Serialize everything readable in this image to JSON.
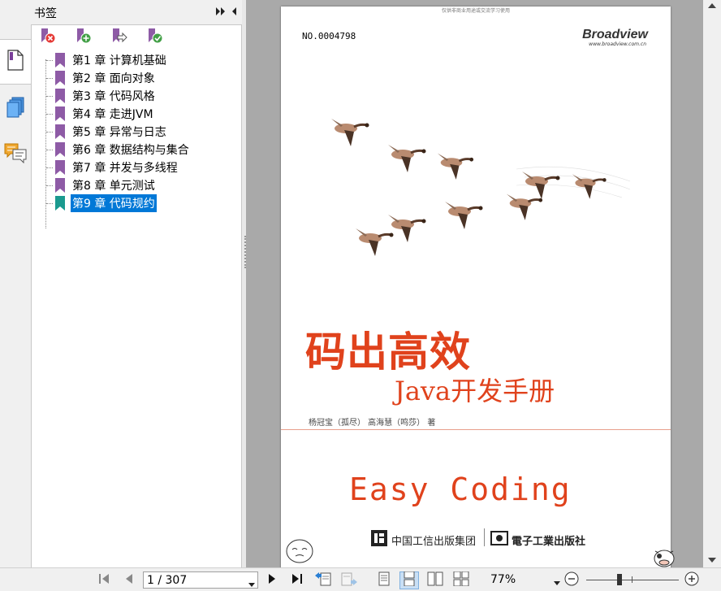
{
  "panel": {
    "title": "书签"
  },
  "bookmarks": [
    {
      "label": "第1 章 计算机基础",
      "selected": false
    },
    {
      "label": "第2 章 面向对象",
      "selected": false
    },
    {
      "label": "第3 章 代码风格",
      "selected": false
    },
    {
      "label": "第4 章 走进JVM",
      "selected": false
    },
    {
      "label": "第5 章 异常与日志",
      "selected": false
    },
    {
      "label": "第6 章 数据结构与集合",
      "selected": false
    },
    {
      "label": "第7 章 并发与多线程",
      "selected": false
    },
    {
      "label": "第8 章 单元测试",
      "selected": false
    },
    {
      "label": "第9 章 代码规约",
      "selected": true
    }
  ],
  "cover": {
    "watermark": "仅供非商业用途或交流学习使用",
    "number": "NO.0004798",
    "brand": "Broadview",
    "brand_url": "www.broadview.com.cn",
    "title": "码出高效",
    "subtitle": "Java开发手册",
    "authors": "杨冠宝（孤尽） 高海慧（鸣莎） 著",
    "english_title": "Easy Coding",
    "publisher1": "中国工信出版集团",
    "publisher2": "電子工業出版社"
  },
  "toolbar": {
    "page_display": "1 / 307",
    "zoom": "77%"
  },
  "colors": {
    "accent_red": "#e0421c",
    "selection": "#0078d7",
    "bookmark_purple": "#8e5ba6",
    "bookmark_teal": "#1b9a8f"
  }
}
